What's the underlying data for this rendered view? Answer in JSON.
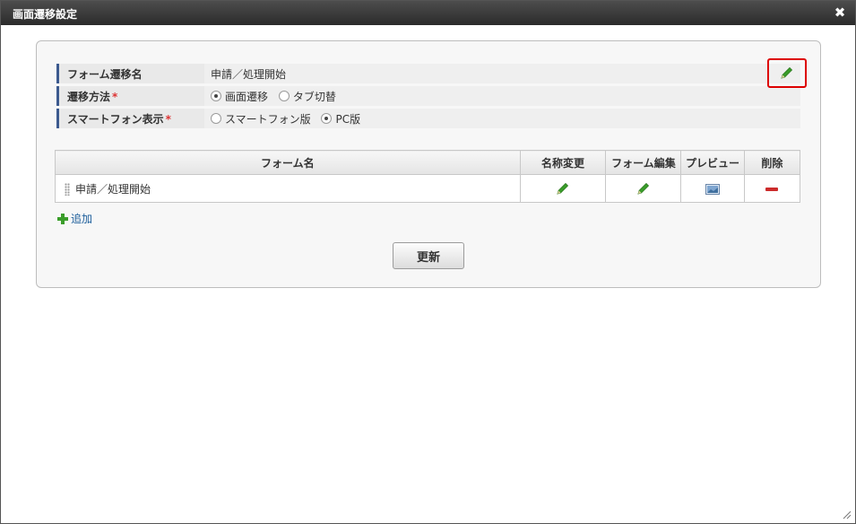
{
  "dialog": {
    "title": "画面遷移設定",
    "close_icon": "close-icon"
  },
  "properties": {
    "form_transition_name": {
      "label": "フォーム遷移名",
      "value": "申請／処理開始"
    },
    "transition_method": {
      "label": "遷移方法",
      "required_mark": "*",
      "options": [
        {
          "label": "画面遷移",
          "selected": true
        },
        {
          "label": "タブ切替",
          "selected": false
        }
      ]
    },
    "smartphone_display": {
      "label": "スマートフォン表示",
      "required_mark": "*",
      "options": [
        {
          "label": "スマートフォン版",
          "selected": false
        },
        {
          "label": "PC版",
          "selected": true
        }
      ]
    }
  },
  "grid": {
    "columns": [
      "フォーム名",
      "名称変更",
      "フォーム編集",
      "プレビュー",
      "削除"
    ],
    "rows": [
      {
        "form_name": "申請／処理開始"
      }
    ]
  },
  "add_label": "追加",
  "update_button": "更新",
  "colors": {
    "pencil_green": "#3a9d2a",
    "delete_red": "#cc2b2b",
    "highlight_red": "#dd0000",
    "label_bar": "#3c5a8f"
  }
}
